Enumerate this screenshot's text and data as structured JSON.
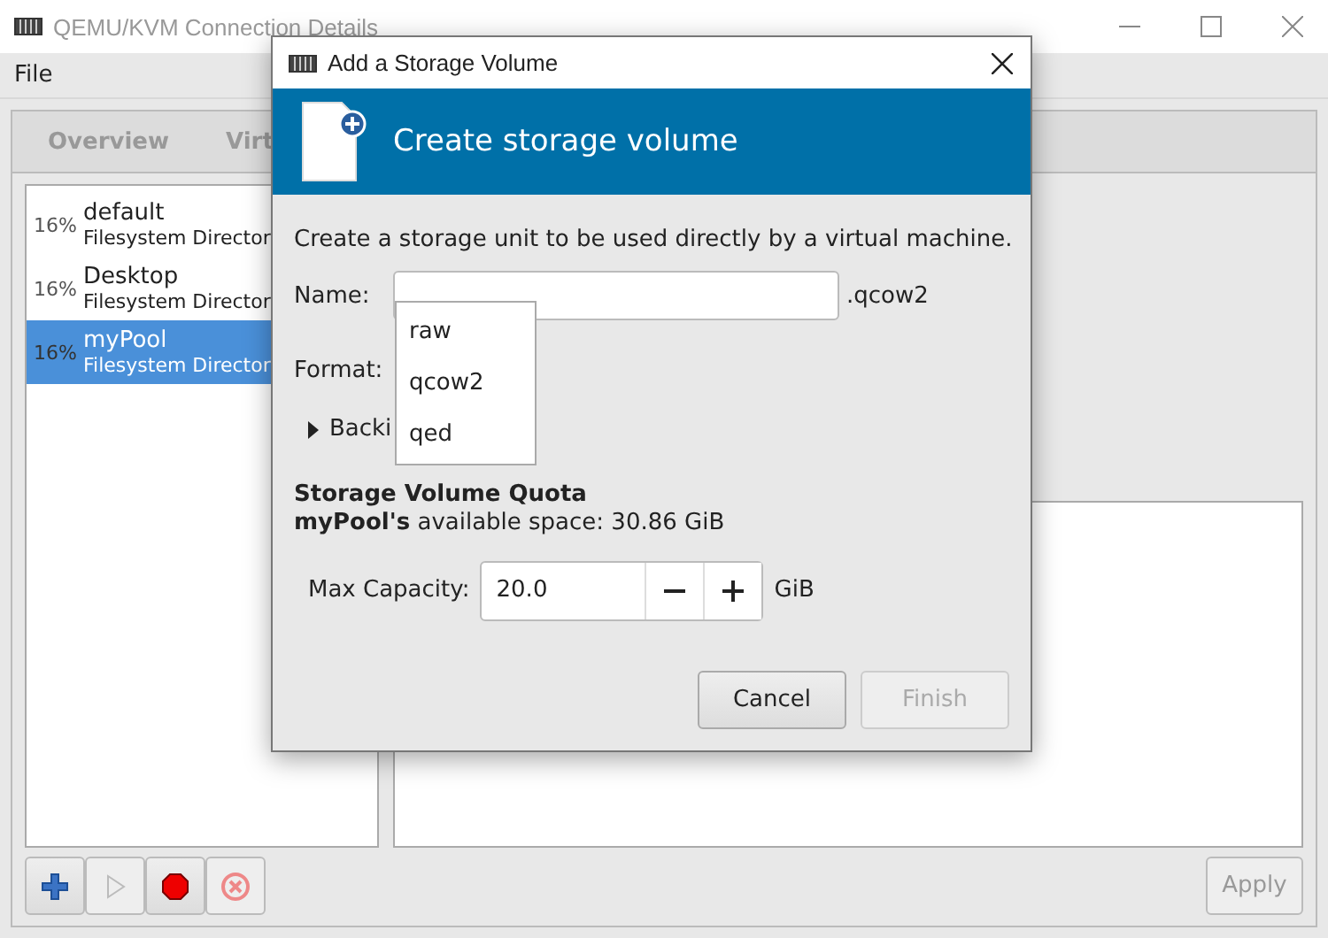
{
  "window": {
    "title": "QEMU/KVM Connection Details"
  },
  "menu": [
    "File"
  ],
  "tabs": [
    {
      "label": "Overview",
      "selected": false
    },
    {
      "label": "Virt",
      "selected": false
    }
  ],
  "pools": [
    {
      "usage": "16%",
      "name": "default",
      "type": "Filesystem Director",
      "selected": false
    },
    {
      "usage": "16%",
      "name": "Desktop",
      "type": "Filesystem Director",
      "selected": false
    },
    {
      "usage": "16%",
      "name": "myPool",
      "type": "Filesystem Director",
      "selected": true
    }
  ],
  "toolbar": [
    {
      "kind": "add",
      "disabled": false
    },
    {
      "kind": "start",
      "disabled": true
    },
    {
      "kind": "stop",
      "disabled": false
    },
    {
      "kind": "delete",
      "disabled": true
    }
  ],
  "apply_button": {
    "label": "Apply",
    "disabled": true
  },
  "dialog": {
    "title": "Add a Storage Volume",
    "header": "Create storage volume",
    "description": "Create a storage unit to be used directly by a virtual machine.",
    "name_label": "Name:",
    "name_suffix": ".qcow2",
    "format_label": "Format:",
    "format_options": [
      {
        "label": "raw",
        "selected": false
      },
      {
        "label": "qcow2",
        "selected": false
      },
      {
        "label": "qed",
        "selected": false
      }
    ],
    "backing_store": {
      "label": "Backi",
      "expanded": false
    },
    "quota_title": "Storage Volume Quota",
    "quota_text": "**myPool's** available space: 30.86 GiB",
    "capacity_label": "Max Capacity:",
    "capacity_value": "20.0",
    "capacity_unit": "GiB",
    "buttons": [
      {
        "label": "Cancel",
        "disabled": false
      },
      {
        "label": "Finish",
        "disabled": true
      }
    ]
  }
}
